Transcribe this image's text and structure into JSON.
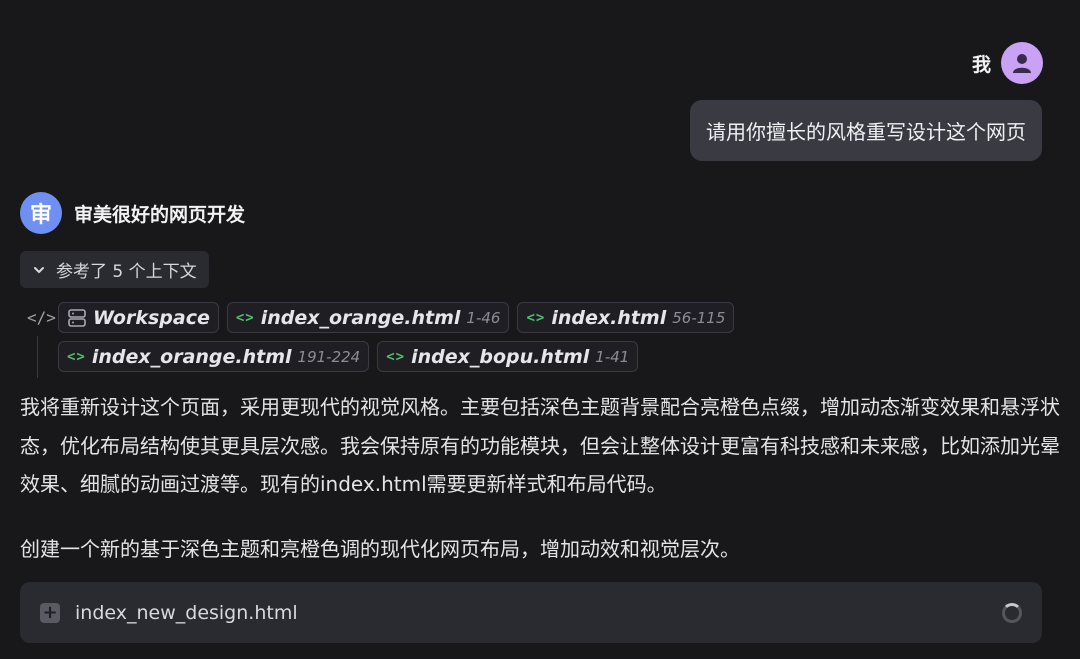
{
  "user": {
    "name": "我",
    "message": "请用你擅长的风格重写设计这个网页"
  },
  "assistant": {
    "avatar_text": "审",
    "name": "审美很好的网页开发",
    "context_toggle": "参考了 5 个上下文",
    "references": [
      {
        "name": "Workspace",
        "range": "",
        "icon": "server-icon"
      },
      {
        "name": "index_orange.html",
        "range": "1-46",
        "icon": "code-icon"
      },
      {
        "name": "index.html",
        "range": "56-115",
        "icon": "code-icon"
      },
      {
        "name": "index_orange.html",
        "range": "191-224",
        "icon": "code-icon"
      },
      {
        "name": "index_bopu.html",
        "range": "1-41",
        "icon": "code-icon"
      }
    ],
    "paragraph1": "我将重新设计这个页面，采用更现代的视觉风格。主要包括深色主题背景配合亮橙色点缀，增加动态渐变效果和悬浮状态，优化布局结构使其更具层次感。我会保持原有的功能模块，但会让整体设计更富有科技感和未来感，比如添加光晕效果、细腻的动画过渡等。现有的index.html需要更新样式和布局代码。",
    "paragraph2": "创建一个新的基于深色主题和亮橙色调的现代化网页布局，增加动效和视觉层次。",
    "file": {
      "name": "index_new_design.html",
      "status": "loading"
    }
  },
  "colors": {
    "background": "#18181b",
    "user_bubble": "#3a3a43",
    "user_avatar": "#c9a2f5",
    "bot_avatar": "#6f8ff2",
    "chip_code": "#4fc06b"
  }
}
